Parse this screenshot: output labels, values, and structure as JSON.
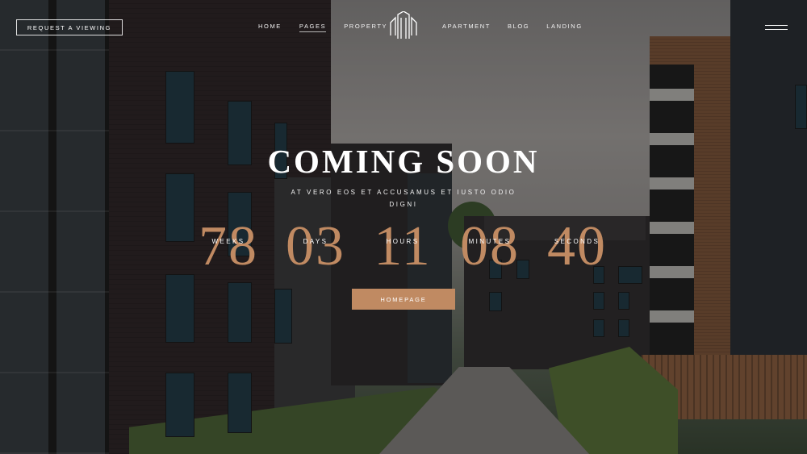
{
  "header": {
    "request_button": "Request a viewing",
    "nav_left": [
      {
        "label": "Home",
        "active": false
      },
      {
        "label": "Pages",
        "active": true
      },
      {
        "label": "Property",
        "active": false
      }
    ],
    "nav_right": [
      {
        "label": "Apartment"
      },
      {
        "label": "Blog"
      },
      {
        "label": "Landing"
      }
    ],
    "logo_icon": "building-logo-icon",
    "menu_icon": "hamburger-menu-icon"
  },
  "hero": {
    "title": "Coming Soon",
    "subtitle": "At vero eos et accusamus et iusto odio digni",
    "button": "Homepage",
    "accent_color": "#c08a62"
  },
  "countdown": [
    {
      "value": "78",
      "label": "Weeks"
    },
    {
      "value": "03",
      "label": "Days"
    },
    {
      "value": "11",
      "label": "Hours"
    },
    {
      "value": "08",
      "label": "Minutes"
    },
    {
      "value": "40",
      "label": "Seconds"
    }
  ]
}
